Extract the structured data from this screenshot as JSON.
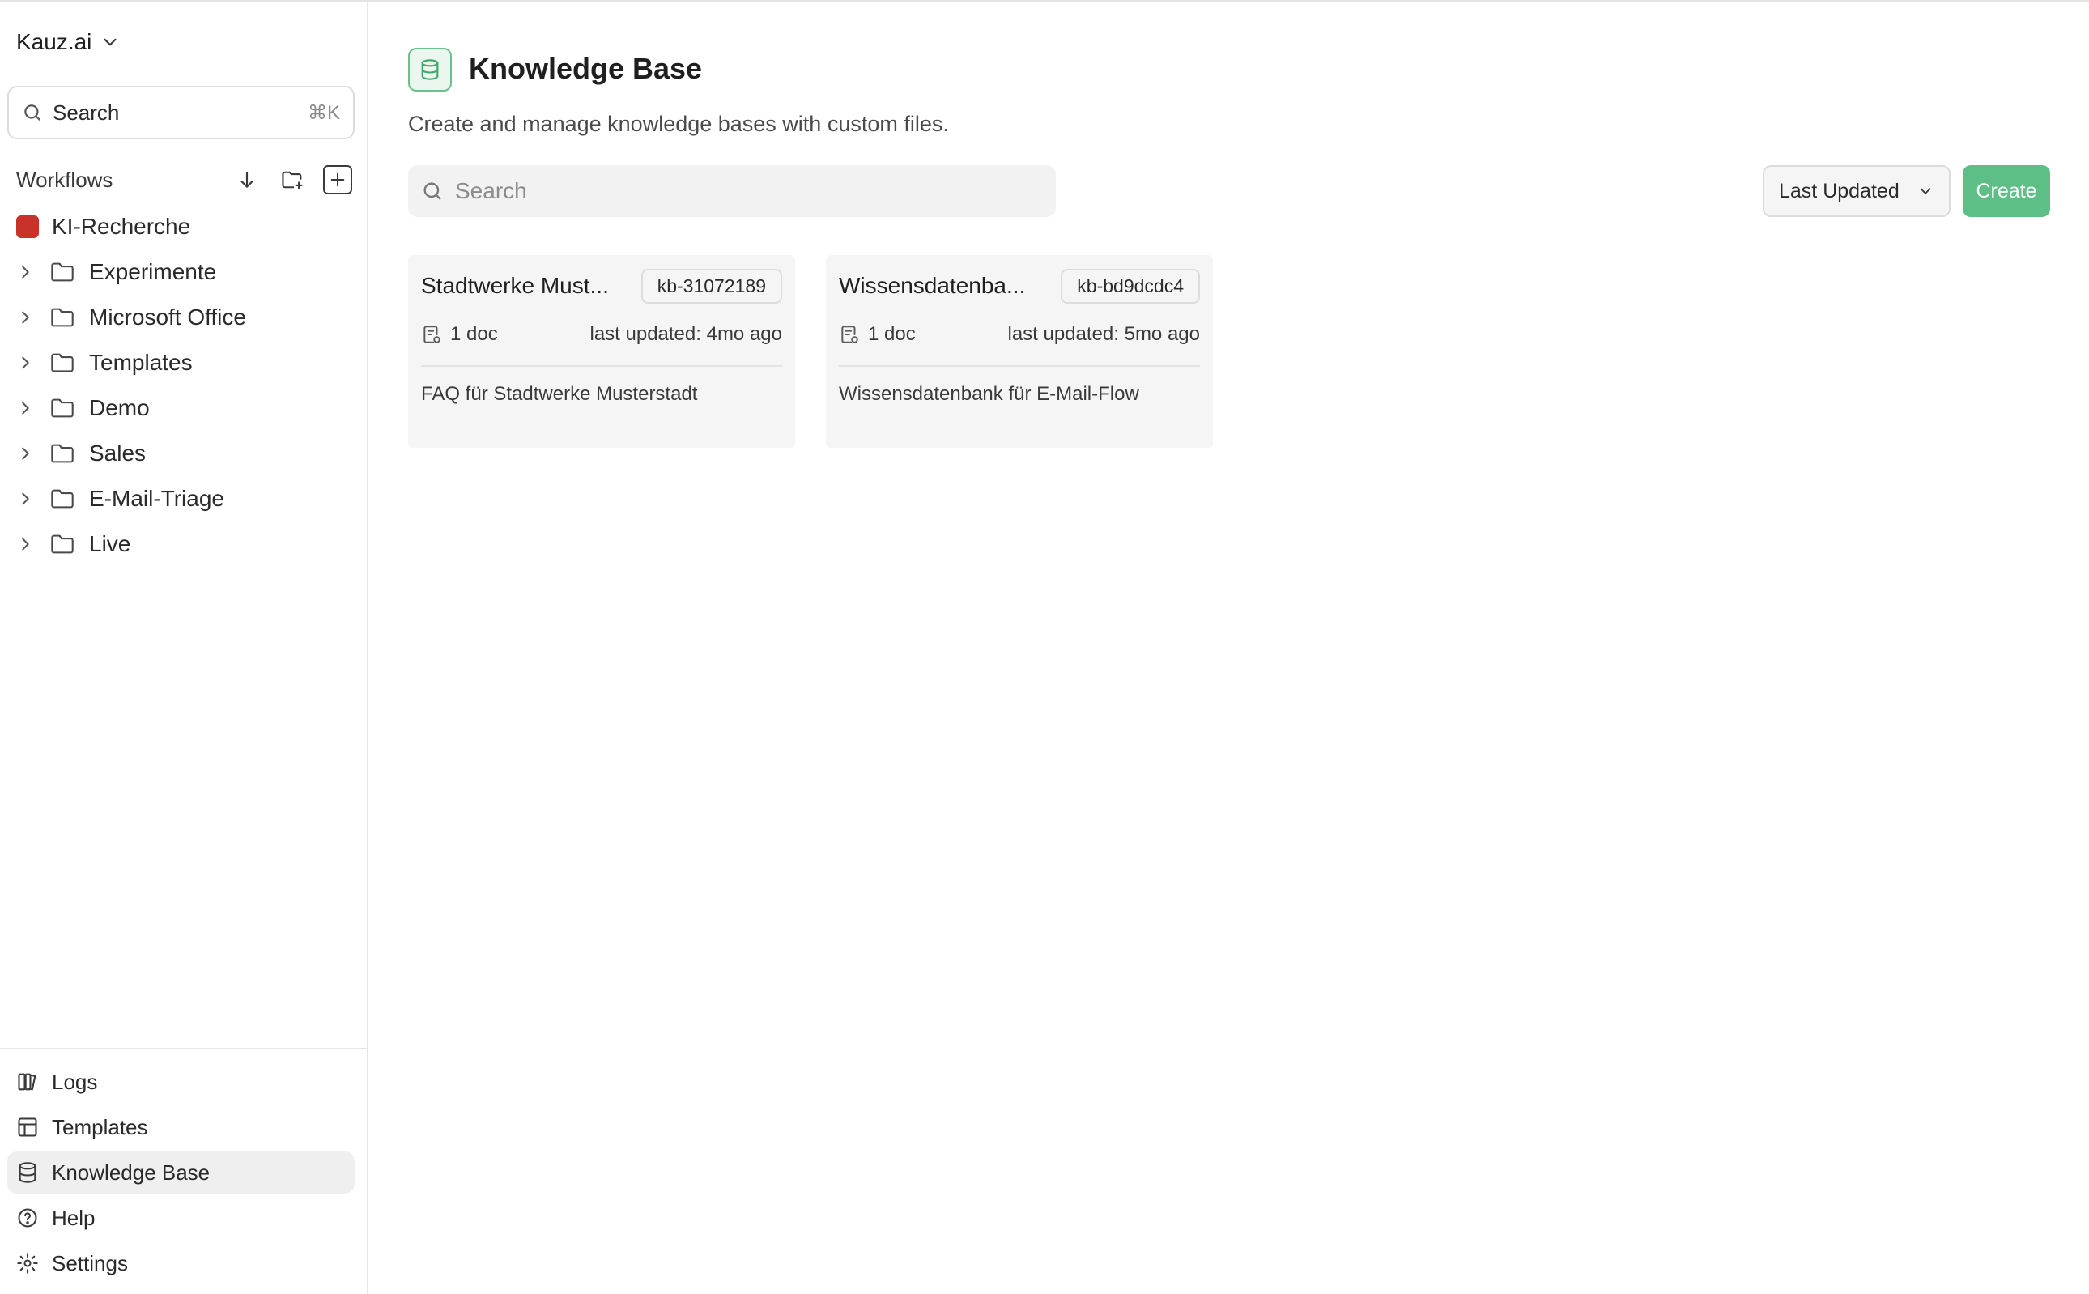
{
  "workspace": {
    "name": "Kauz.ai"
  },
  "sidebar": {
    "search": {
      "placeholder": "Search",
      "shortcut": "⌘K"
    },
    "workflows_title": "Workflows",
    "workflows": [
      {
        "label": "KI-Recherche",
        "type": "workflow",
        "color": "#c8322b"
      },
      {
        "label": "Experimente",
        "type": "folder"
      },
      {
        "label": "Microsoft Office",
        "type": "folder"
      },
      {
        "label": "Templates",
        "type": "folder"
      },
      {
        "label": "Demo",
        "type": "folder"
      },
      {
        "label": "Sales",
        "type": "folder"
      },
      {
        "label": "E-Mail-Triage",
        "type": "folder"
      },
      {
        "label": "Live",
        "type": "folder"
      }
    ],
    "nav": [
      {
        "label": "Logs",
        "icon": "logs-icon"
      },
      {
        "label": "Templates",
        "icon": "templates-icon"
      },
      {
        "label": "Knowledge Base",
        "icon": "database-icon",
        "active": true
      },
      {
        "label": "Help",
        "icon": "help-icon"
      },
      {
        "label": "Settings",
        "icon": "settings-icon"
      }
    ]
  },
  "main": {
    "title": "Knowledge Base",
    "subtitle": "Create and manage knowledge bases with custom files.",
    "search_placeholder": "Search",
    "sort_label": "Last Updated",
    "create_label": "Create",
    "accent": "#5ebf86",
    "cards": [
      {
        "name": "Stadtwerke Must...",
        "id": "kb-31072189",
        "docs": "1 doc",
        "updated": "last updated: 4mo ago",
        "description": "FAQ für Stadtwerke Musterstadt"
      },
      {
        "name": "Wissensdatenba...",
        "id": "kb-bd9dcdc4",
        "docs": "1 doc",
        "updated": "last updated: 5mo ago",
        "description": "Wissensdatenbank für E-Mail-Flow"
      }
    ]
  }
}
